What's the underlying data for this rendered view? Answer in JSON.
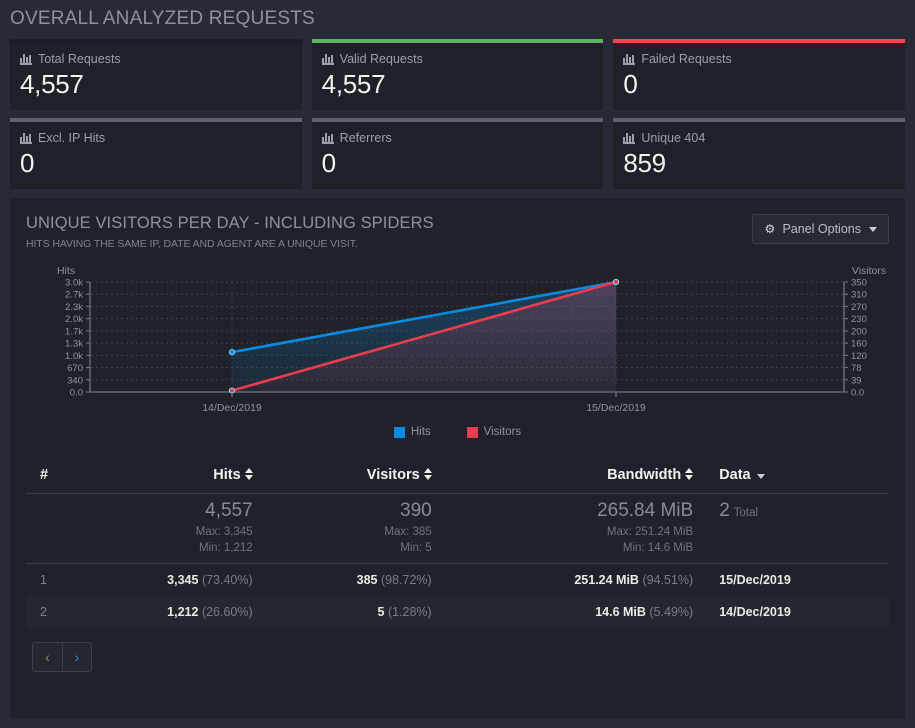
{
  "overall": {
    "title": "OVERALL ANALYZED REQUESTS",
    "cards": [
      {
        "label": "Total Requests",
        "value": "4,557",
        "icon": "bar-chart-icon",
        "accent": "none",
        "accent_color": "#1b1e24"
      },
      {
        "label": "Valid Requests",
        "value": "4,557",
        "icon": "bar-chart-icon",
        "accent": "green",
        "accent_color": "#5fb55f"
      },
      {
        "label": "Failed Requests",
        "value": "0",
        "icon": "bar-chart-icon",
        "accent": "red",
        "accent_color": "#f9434f"
      },
      {
        "label": "Excl. IP Hits",
        "value": "0",
        "icon": "bar-chart-icon",
        "accent": "grey",
        "accent_color": "#5c6470"
      },
      {
        "label": "Referrers",
        "value": "0",
        "icon": "bar-chart-icon",
        "accent": "grey",
        "accent_color": "#5c6470"
      },
      {
        "label": "Unique 404",
        "value": "859",
        "icon": "bar-chart-icon",
        "accent": "grey",
        "accent_color": "#5c6470"
      }
    ]
  },
  "panel": {
    "title": "UNIQUE VISITORS PER DAY - INCLUDING SPIDERS",
    "subtitle": "HITS HAVING THE SAME IP, DATE AND AGENT ARE A UNIQUE VISIT.",
    "options_label": "Panel Options",
    "options_icon": "gear-icon",
    "caret_icon": "caret-down-icon"
  },
  "chart_data": {
    "type": "line",
    "title": "",
    "x": [
      "14/Dec/2019",
      "15/Dec/2019"
    ],
    "xlabel": "",
    "series": [
      {
        "name": "Hits",
        "values": [
          1212,
          3345
        ],
        "color": "#0c8be0",
        "axis": "left"
      },
      {
        "name": "Visitors",
        "values": [
          5,
          385
        ],
        "color": "#ea3d4f",
        "axis": "right"
      }
    ],
    "left_axis": {
      "label": "Hits",
      "ticks": [
        "0.0",
        "340",
        "670",
        "1.0k",
        "1.3k",
        "1.7k",
        "2.0k",
        "2.3k",
        "2.7k",
        "3.0k"
      ],
      "min": 0,
      "max": 3345
    },
    "right_axis": {
      "label": "Visitors",
      "ticks": [
        "0.0",
        "39",
        "78",
        "120",
        "160",
        "200",
        "230",
        "270",
        "310",
        "350"
      ],
      "min": 0,
      "max": 385
    },
    "grid": true,
    "legend": [
      "Hits",
      "Visitors"
    ],
    "legend_position": "bottom"
  },
  "table": {
    "headers": {
      "hash": "#",
      "hits": "Hits",
      "visitors": "Visitors",
      "bandwidth": "Bandwidth",
      "data": "Data"
    },
    "summary": {
      "hits_total": "4,557",
      "hits_max": "Max: 3,345",
      "hits_min": "Min: 1,212",
      "visitors_total": "390",
      "visitors_max": "Max: 385",
      "visitors_min": "Min: 5",
      "bandwidth_total": "265.84 MiB",
      "bandwidth_max": "Max: 251.24 MiB",
      "bandwidth_min": "Min: 14.6 MiB",
      "count": "2",
      "count_label": "Total"
    },
    "rows": [
      {
        "idx": "1",
        "hits": "3,345",
        "hits_pct": "(73.40%)",
        "visitors": "385",
        "visitors_pct": "(98.72%)",
        "bandwidth": "251.24 MiB",
        "bandwidth_pct": "(94.51%)",
        "data": "15/Dec/2019"
      },
      {
        "idx": "2",
        "hits": "1,212",
        "hits_pct": "(26.60%)",
        "visitors": "5",
        "visitors_pct": "(1.28%)",
        "bandwidth": "14.6 MiB",
        "bandwidth_pct": "(5.49%)",
        "data": "14/Dec/2019"
      }
    ]
  },
  "pager": {
    "prev_icon": "chevron-left-icon",
    "next_icon": "chevron-right-icon",
    "prev_label": "‹",
    "next_label": "›"
  }
}
